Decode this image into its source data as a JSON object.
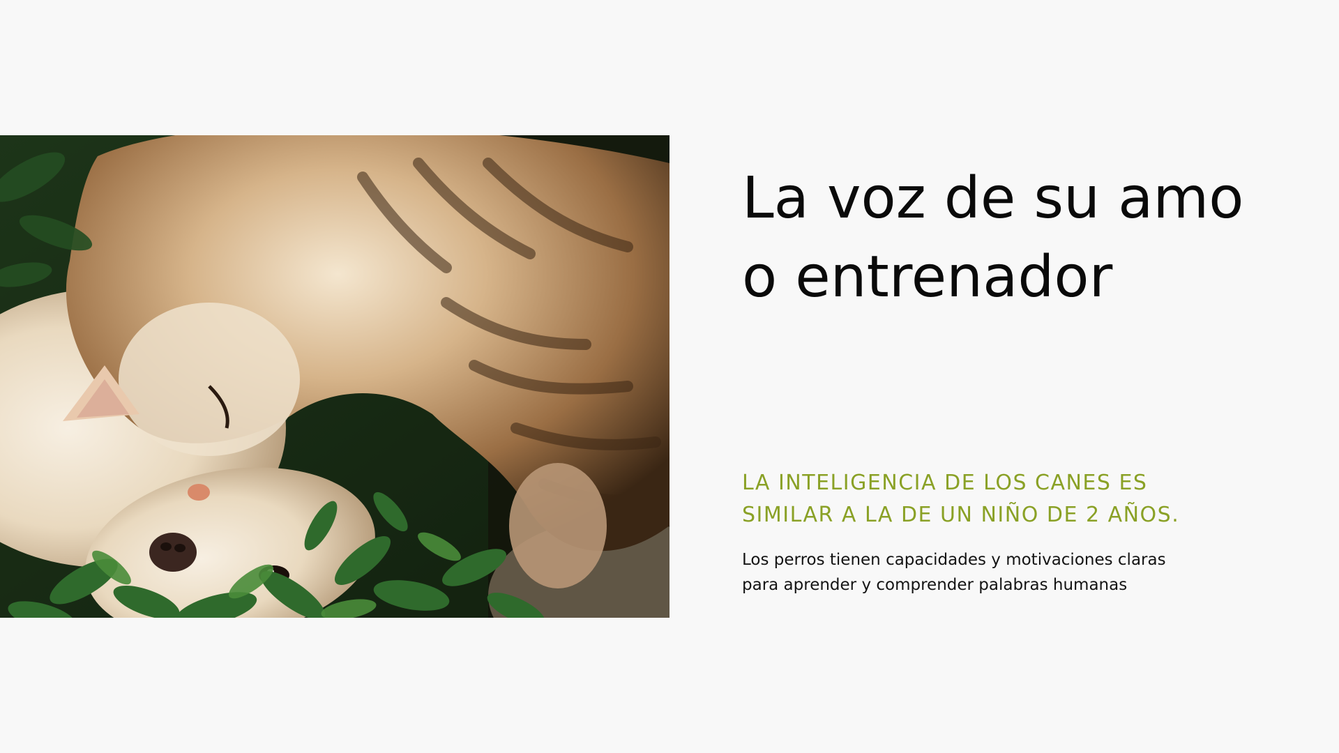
{
  "slide": {
    "title_lines": [
      "La voz de su amo",
      "o entrenador"
    ],
    "subtitle_lines": [
      "LA INTELIGENCIA DE LOS CANES ES",
      "SIMILAR A LA DE UN NIÑO DE 2 AÑOS."
    ],
    "body_lines": [
      "Los perros tienen capacidades y motivaciones claras",
      "para aprender y comprender palabras humanas"
    ]
  },
  "colors": {
    "background": "#f8f8f8",
    "title": "#0a0a0a",
    "accent": "#8aa126",
    "body": "#141414"
  },
  "photo": {
    "subject": "cat-and-dog-photo"
  }
}
